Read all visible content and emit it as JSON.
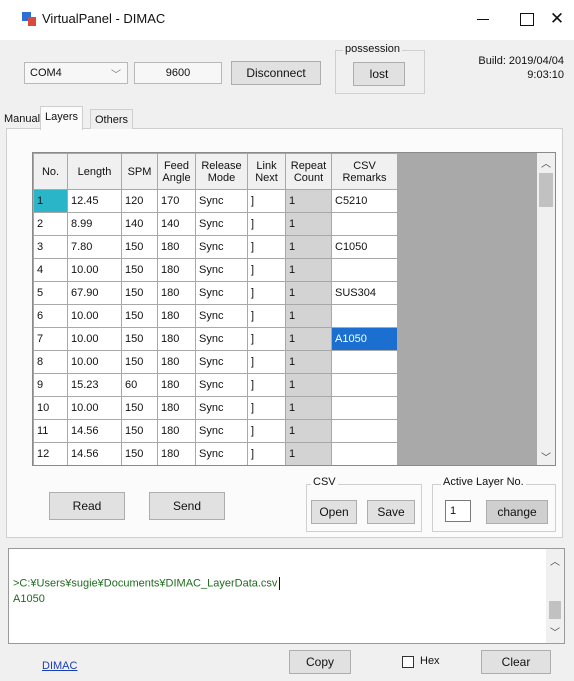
{
  "window": {
    "title": "VirtualPanel - DIMAC",
    "minimize_glyph": "",
    "close_glyph": "✕"
  },
  "connection": {
    "port": "COM4",
    "baud": "9600",
    "disconnect_label": "Disconnect",
    "possession_label": "possession",
    "possession_value": "lost",
    "build_line1": "Build: 2019/04/04",
    "build_line2": "9:03:10"
  },
  "tabs": [
    {
      "label": "Manual"
    },
    {
      "label": "Layers"
    },
    {
      "label": "Others"
    }
  ],
  "grid": {
    "headers": [
      "No.",
      "Length",
      "SPM",
      "Feed\nAngle",
      "Release\nMode",
      "Link\nNext",
      "Repeat\nCount",
      "CSV\nRemarks"
    ],
    "rows": [
      [
        "1",
        "12.45",
        "120",
        "170",
        "Sync",
        "]",
        "1",
        "C5210"
      ],
      [
        "2",
        "8.99",
        "140",
        "140",
        "Sync",
        "]",
        "1",
        ""
      ],
      [
        "3",
        "7.80",
        "150",
        "180",
        "Sync",
        "]",
        "1",
        "C1050"
      ],
      [
        "4",
        "10.00",
        "150",
        "180",
        "Sync",
        "]",
        "1",
        ""
      ],
      [
        "5",
        "67.90",
        "150",
        "180",
        "Sync",
        "]",
        "1",
        "SUS304"
      ],
      [
        "6",
        "10.00",
        "150",
        "180",
        "Sync",
        "]",
        "1",
        ""
      ],
      [
        "7",
        "10.00",
        "150",
        "180",
        "Sync",
        "]",
        "1",
        "A1050"
      ],
      [
        "8",
        "10.00",
        "150",
        "180",
        "Sync",
        "]",
        "1",
        ""
      ],
      [
        "9",
        "15.23",
        "60",
        "180",
        "Sync",
        "]",
        "1",
        ""
      ],
      [
        "10",
        "10.00",
        "150",
        "180",
        "Sync",
        "]",
        "1",
        ""
      ],
      [
        "11",
        "14.56",
        "150",
        "180",
        "Sync",
        "]",
        "1",
        ""
      ],
      [
        "12",
        "14.56",
        "150",
        "180",
        "Sync",
        "]",
        "1",
        ""
      ]
    ],
    "selected_row": 7
  },
  "actions": {
    "read_label": "Read",
    "send_label": "Send",
    "csv_label": "CSV",
    "open_label": "Open",
    "save_label": "Save",
    "active_layer_label": "Active Layer No.",
    "active_layer_value": "1",
    "change_label": "change"
  },
  "log": {
    "line1": ">C:¥Users¥sugie¥Documents¥DIMAC_LayerData.csv",
    "line2": "A1050"
  },
  "footer": {
    "link_label": "DIMAC",
    "copy_label": "Copy",
    "hex_label": "Hex",
    "hex_checked": false,
    "clear_label": "Clear"
  },
  "colors": {
    "selection_cell": "#1b6fd1",
    "current_row_marker": "#2ab5c8",
    "log_text": "#1f6b1f",
    "link": "#1a3fb0"
  }
}
